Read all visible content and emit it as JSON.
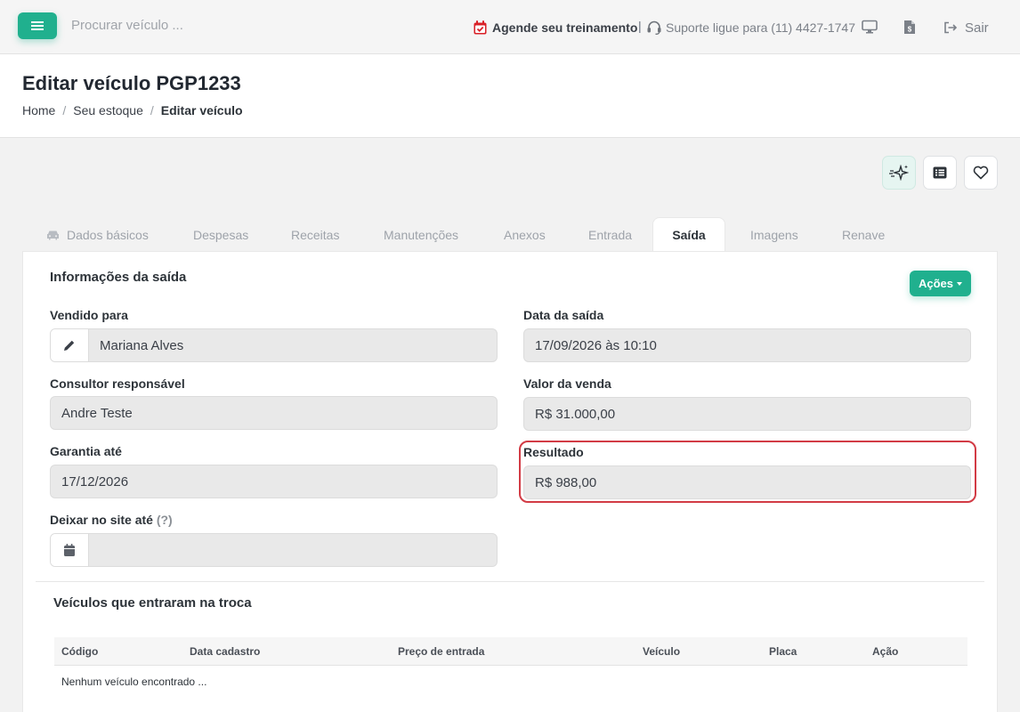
{
  "topbar": {
    "search_placeholder": "Procurar veículo ...",
    "training_label": "Agende seu treinamento",
    "separator": "|",
    "support_label": "Suporte ligue para (11) 4427-1747",
    "logout_label": "Sair"
  },
  "header": {
    "title": "Editar veículo PGP1233",
    "breadcrumb": [
      "Home",
      "Seu estoque",
      "Editar veículo"
    ],
    "breadcrumb_separator": "/"
  },
  "tabs": [
    {
      "label": "Dados básicos",
      "icon": "car-icon"
    },
    {
      "label": "Despesas"
    },
    {
      "label": "Receitas"
    },
    {
      "label": "Manutenções"
    },
    {
      "label": "Anexos"
    },
    {
      "label": "Entrada"
    },
    {
      "label": "Saída",
      "active": true
    },
    {
      "label": "Imagens"
    },
    {
      "label": "Renave"
    }
  ],
  "saida": {
    "section_title": "Informações da saída",
    "actions_label": "Ações",
    "vendido_para": {
      "label": "Vendido para",
      "value": "Mariana Alves"
    },
    "data_saida": {
      "label": "Data da saída",
      "value": "17/09/2026 às 10:10"
    },
    "consultor": {
      "label": "Consultor responsável",
      "value": "Andre Teste"
    },
    "valor_venda": {
      "label": "Valor da venda",
      "value": "R$ 31.000,00"
    },
    "garantia": {
      "label": "Garantia até",
      "value": "17/12/2026"
    },
    "resultado": {
      "label": "Resultado",
      "value": "R$ 988,00"
    },
    "deixar_site": {
      "label": "Deixar no site até",
      "help": "(?)",
      "value": ""
    }
  },
  "troca": {
    "section_title": "Veículos que entraram na troca",
    "columns": [
      "Código",
      "Data cadastro",
      "Preço de entrada",
      "Veículo",
      "Placa",
      "Ação"
    ],
    "empty_message": "Nenhum veículo encontrado ..."
  },
  "colors": {
    "accent": "#20b08e",
    "highlight_border": "#d23b45",
    "calendar_red": "#d92027"
  }
}
